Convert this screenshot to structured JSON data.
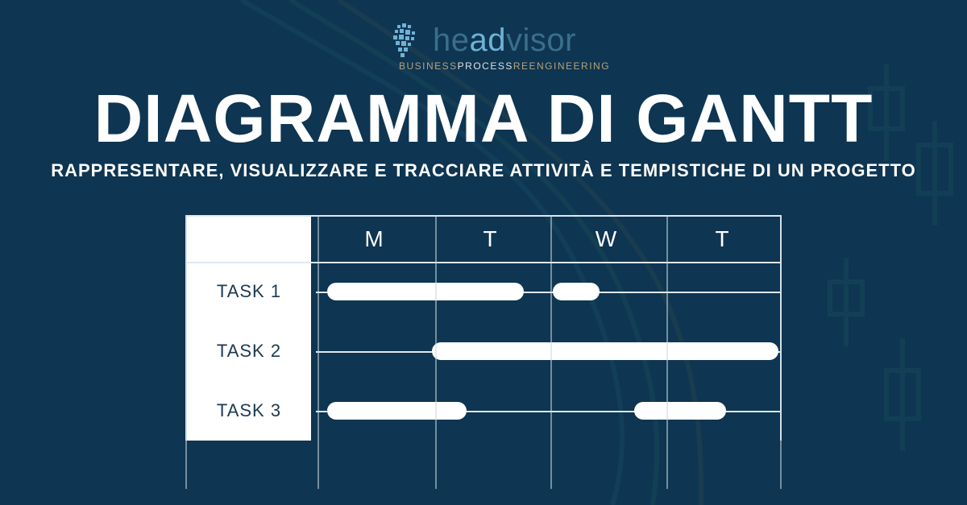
{
  "logo": {
    "word_plain_pre": "h",
    "word_plain_mid": "e",
    "word_accent": "ad",
    "word_plain_post": "visor",
    "tagline_pre": "BUSINESS",
    "tagline_mid": "PROCESS",
    "tagline_post": "REENGINEERING"
  },
  "title": "DIAGRAMMA DI GANTT",
  "subtitle": "RAPPRESENTARE, VISUALIZZARE E TRACCIARE ATTIVITÀ E TEMPISTICHE DI UN PROGETTO",
  "chart_data": {
    "type": "bar",
    "orientation": "horizontal-gantt",
    "categories": [
      "M",
      "T",
      "W",
      "T"
    ],
    "x_unit_per_category": 1.0,
    "xlim": [
      0,
      4
    ],
    "rows": [
      "TASK 1",
      "TASK 2",
      "TASK 3"
    ],
    "series": [
      {
        "name": "TASK 1",
        "bars": [
          {
            "start": 0.1,
            "end": 1.8
          },
          {
            "start": 2.05,
            "end": 2.45
          }
        ]
      },
      {
        "name": "TASK 2",
        "bars": [
          {
            "start": 1.0,
            "end": 4.0
          }
        ]
      },
      {
        "name": "TASK 3",
        "bars": [
          {
            "start": 0.1,
            "end": 1.3
          },
          {
            "start": 2.75,
            "end": 3.55
          }
        ]
      }
    ],
    "title": "",
    "xlabel": "",
    "ylabel": ""
  },
  "colors": {
    "background": "#0e3551",
    "grid": "#dfe8ee",
    "bar": "#ffffff",
    "label_bg": "#ffffff",
    "label_fg": "#1b3a50",
    "brand_dim": "#3a6e8c",
    "brand_accent": "#6fb2d6",
    "tag_gold": "#b7a27b"
  }
}
